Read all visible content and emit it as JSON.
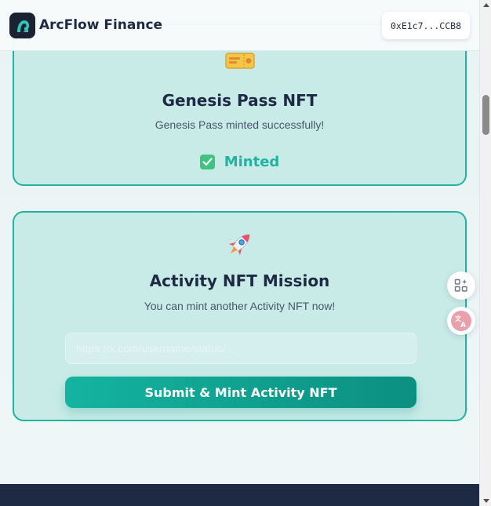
{
  "header": {
    "app_title": "ArcFlow Finance",
    "wallet_address": "0xE1c7...CCB8"
  },
  "genesis_card": {
    "icon": "ticket-icon",
    "title": "Genesis Pass NFT",
    "description": "Genesis Pass minted successfully!",
    "status_icon": "check-box-icon",
    "status_label": "Minted"
  },
  "activity_card": {
    "icon": "rocket-icon",
    "title": "Activity NFT Mission",
    "description": "You can mint another Activity NFT now!",
    "url_placeholder": "https://x.com/username/status/...",
    "url_value": "",
    "submit_label": "Submit & Mint Activity NFT"
  },
  "floating_tools": [
    {
      "icon": "apps-sparkle-icon"
    },
    {
      "icon": "translate-icon"
    }
  ],
  "colors": {
    "accent": "#1fb3a0",
    "card_bg": "#c8ebe8",
    "dark": "#1e2a44",
    "button_start": "#14b4a0",
    "button_end": "#0c8f80"
  }
}
